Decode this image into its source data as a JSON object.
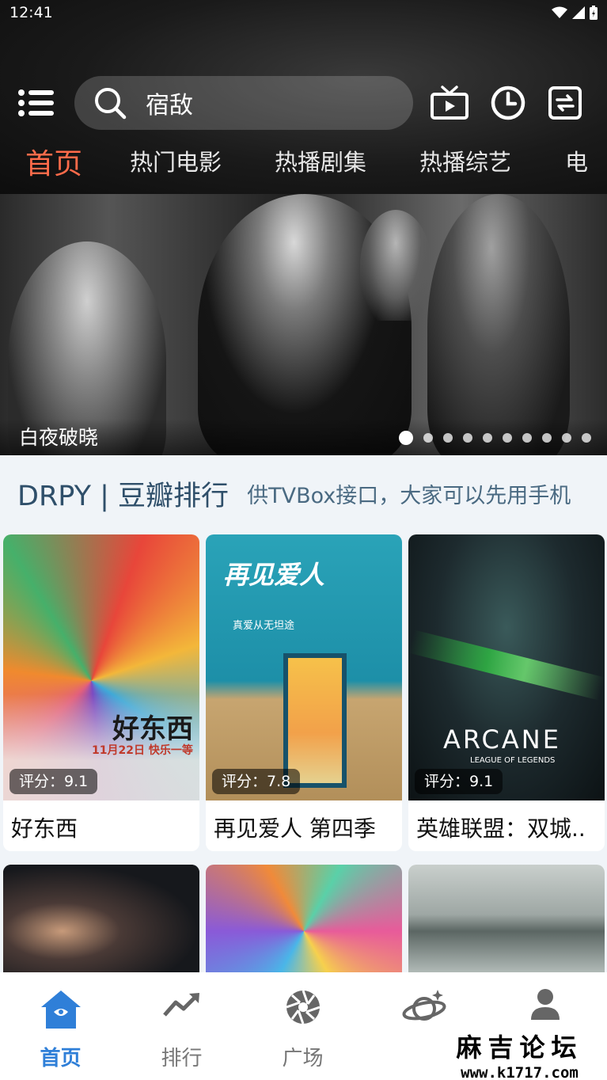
{
  "status_bar": {
    "time": "12:41"
  },
  "search": {
    "query": "宿敌"
  },
  "tabs": [
    {
      "label": "首页",
      "active": true
    },
    {
      "label": "热门电影"
    },
    {
      "label": "热播剧集"
    },
    {
      "label": "热播综艺"
    },
    {
      "label": "电"
    }
  ],
  "banner": {
    "title": "白夜破晓",
    "dot_count": 10,
    "active_dot": 0
  },
  "section": {
    "title": "DRPY | 豆瓣排行",
    "marquee": "供TVBox接口，大家可以先用手机"
  },
  "cards": [
    {
      "title": "好东西",
      "rating": "评分：9.1",
      "poster_text": "好东西",
      "poster_sub": "11月22日 快乐一等"
    },
    {
      "title": "再见爱人 第四季",
      "rating": "评分：7.8",
      "poster_text": "再见爱人",
      "poster_sub": "真爱从无坦途"
    },
    {
      "title": "英雄联盟：双城..",
      "rating": "评分：9.1",
      "poster_text": "ARCANE",
      "poster_sub": "LEAGUE OF LEGENDS"
    }
  ],
  "bottom_nav": [
    {
      "label": "首页",
      "icon": "home-icon",
      "active": true
    },
    {
      "label": "排行",
      "icon": "trending-icon"
    },
    {
      "label": "广场",
      "icon": "aperture-icon"
    },
    {
      "label": "",
      "icon": "planet-icon"
    },
    {
      "label": "",
      "icon": "user-icon"
    }
  ],
  "watermark": {
    "title": "麻吉论坛",
    "url": "www.k1717.com"
  },
  "colors": {
    "accent_tab": "#ff6b4a",
    "nav_active": "#2f7fd8",
    "section_title": "#2f4f6a"
  }
}
